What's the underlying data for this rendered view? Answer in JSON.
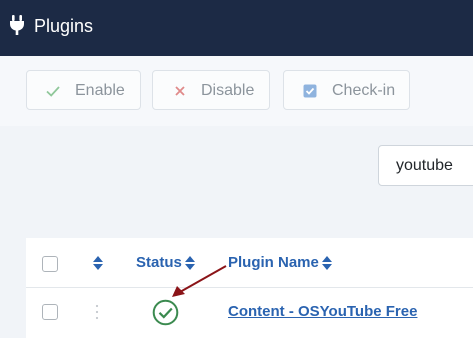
{
  "header": {
    "icon": "plug-icon",
    "title": "Plugins",
    "bg_color": "#1c2a45"
  },
  "toolbar": {
    "enable_label": "Enable",
    "disable_label": "Disable",
    "checkin_label": "Check-in"
  },
  "search": {
    "value": "youtube"
  },
  "table": {
    "columns": {
      "status": "Status",
      "plugin_name": "Plugin Name"
    },
    "rows": [
      {
        "status": "enabled",
        "plugin_name": "Content - OSYouTube Free"
      }
    ]
  },
  "colors": {
    "accent": "#2a63b0",
    "status_ok": "#3b8a4f",
    "annotation_arrow": "#8b1418"
  }
}
